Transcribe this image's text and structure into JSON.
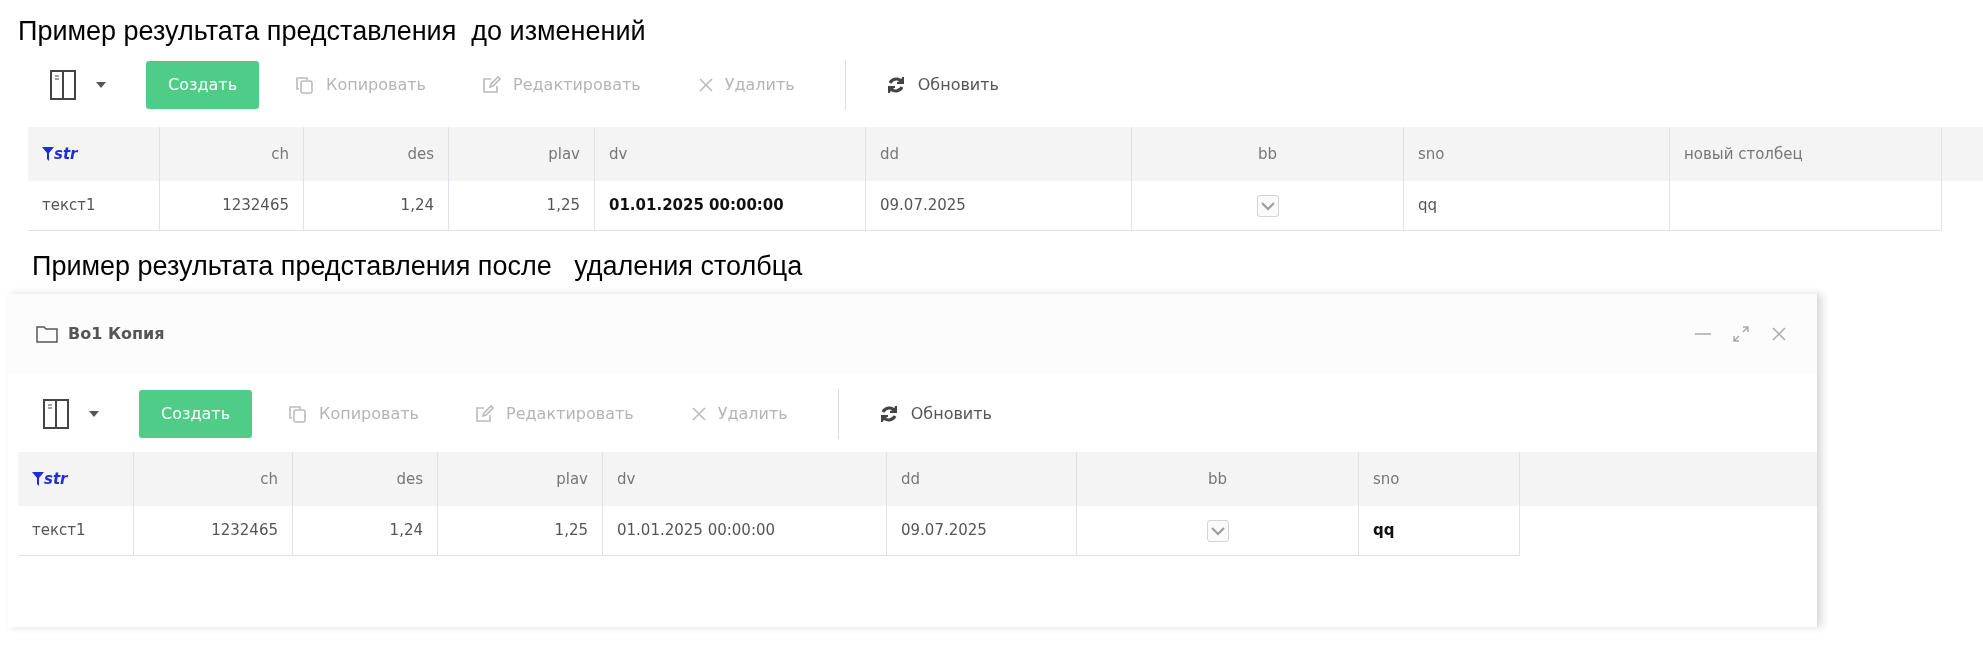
{
  "sections": [
    {
      "caption": "Пример результата представления  до изменений",
      "toolbar": [
        {
          "kind": "layout"
        },
        {
          "kind": "create",
          "label": "Создать"
        },
        {
          "kind": "copy",
          "label": "Копировать",
          "disabled": true
        },
        {
          "kind": "edit",
          "label": "Редактировать",
          "disabled": true
        },
        {
          "kind": "delete",
          "label": "Удалить",
          "disabled": true
        },
        {
          "kind": "divider"
        },
        {
          "kind": "refresh",
          "label": "Обновить",
          "disabled": false
        }
      ],
      "table": {
        "columns": [
          {
            "label": "str",
            "kind": "text",
            "filtered": true
          },
          {
            "label": "ch",
            "kind": "number",
            "filtered": false
          },
          {
            "label": "des",
            "kind": "number",
            "filtered": false
          },
          {
            "label": "plav",
            "kind": "number",
            "filtered": false
          },
          {
            "label": "dv",
            "kind": "text",
            "filtered": false
          },
          {
            "label": "dd",
            "kind": "text",
            "filtered": false
          },
          {
            "label": "bb",
            "kind": "checkbox",
            "filtered": false
          },
          {
            "label": "sno",
            "kind": "text",
            "filtered": false
          },
          {
            "label": "новый столбец",
            "kind": "text",
            "filtered": false
          }
        ],
        "rows": [
          {
            "cells": [
              {
                "text": "текст1",
                "bold": false
              },
              {
                "text": "1232465",
                "bold": false
              },
              {
                "text": "1,24",
                "bold": false
              },
              {
                "text": "1,25",
                "bold": false
              },
              {
                "text": "01.01.2025 00:00:00",
                "bold": true
              },
              {
                "text": "09.07.2025",
                "bold": false
              },
              {
                "checked": true
              },
              {
                "text": "qq",
                "bold": false
              }
            ]
          }
        ]
      }
    },
    {
      "caption": "Пример результата представления после   удаления столбца",
      "window": {
        "title": "Во1 Копия"
      },
      "toolbar": [
        {
          "kind": "layout"
        },
        {
          "kind": "create",
          "label": "Создать"
        },
        {
          "kind": "copy",
          "label": "Копировать",
          "disabled": true
        },
        {
          "kind": "edit",
          "label": "Редактировать",
          "disabled": true
        },
        {
          "kind": "delete",
          "label": "Удалить",
          "disabled": true
        },
        {
          "kind": "divider"
        },
        {
          "kind": "refresh",
          "label": "Обновить",
          "disabled": false
        }
      ],
      "table": {
        "columns": [
          {
            "label": "str",
            "kind": "text",
            "filtered": true
          },
          {
            "label": "ch",
            "kind": "number",
            "filtered": false
          },
          {
            "label": "des",
            "kind": "number",
            "filtered": false
          },
          {
            "label": "plav",
            "kind": "number",
            "filtered": false
          },
          {
            "label": "dv",
            "kind": "text",
            "filtered": false
          },
          {
            "label": "dd",
            "kind": "text",
            "filtered": false
          },
          {
            "label": "bb",
            "kind": "checkbox",
            "filtered": false
          },
          {
            "label": "sno",
            "kind": "text",
            "filtered": false
          }
        ],
        "rows": [
          {
            "cells": [
              {
                "text": "текст1",
                "bold": false
              },
              {
                "text": "1232465",
                "bold": false
              },
              {
                "text": "1,24",
                "bold": false
              },
              {
                "text": "1,25",
                "bold": false
              },
              {
                "text": "01.01.2025 00:00:00",
                "bold": false
              },
              {
                "text": "09.07.2025",
                "bold": false
              },
              {
                "checked": true
              },
              {
                "text": "qq",
                "bold": true
              }
            ]
          }
        ]
      }
    }
  ]
}
